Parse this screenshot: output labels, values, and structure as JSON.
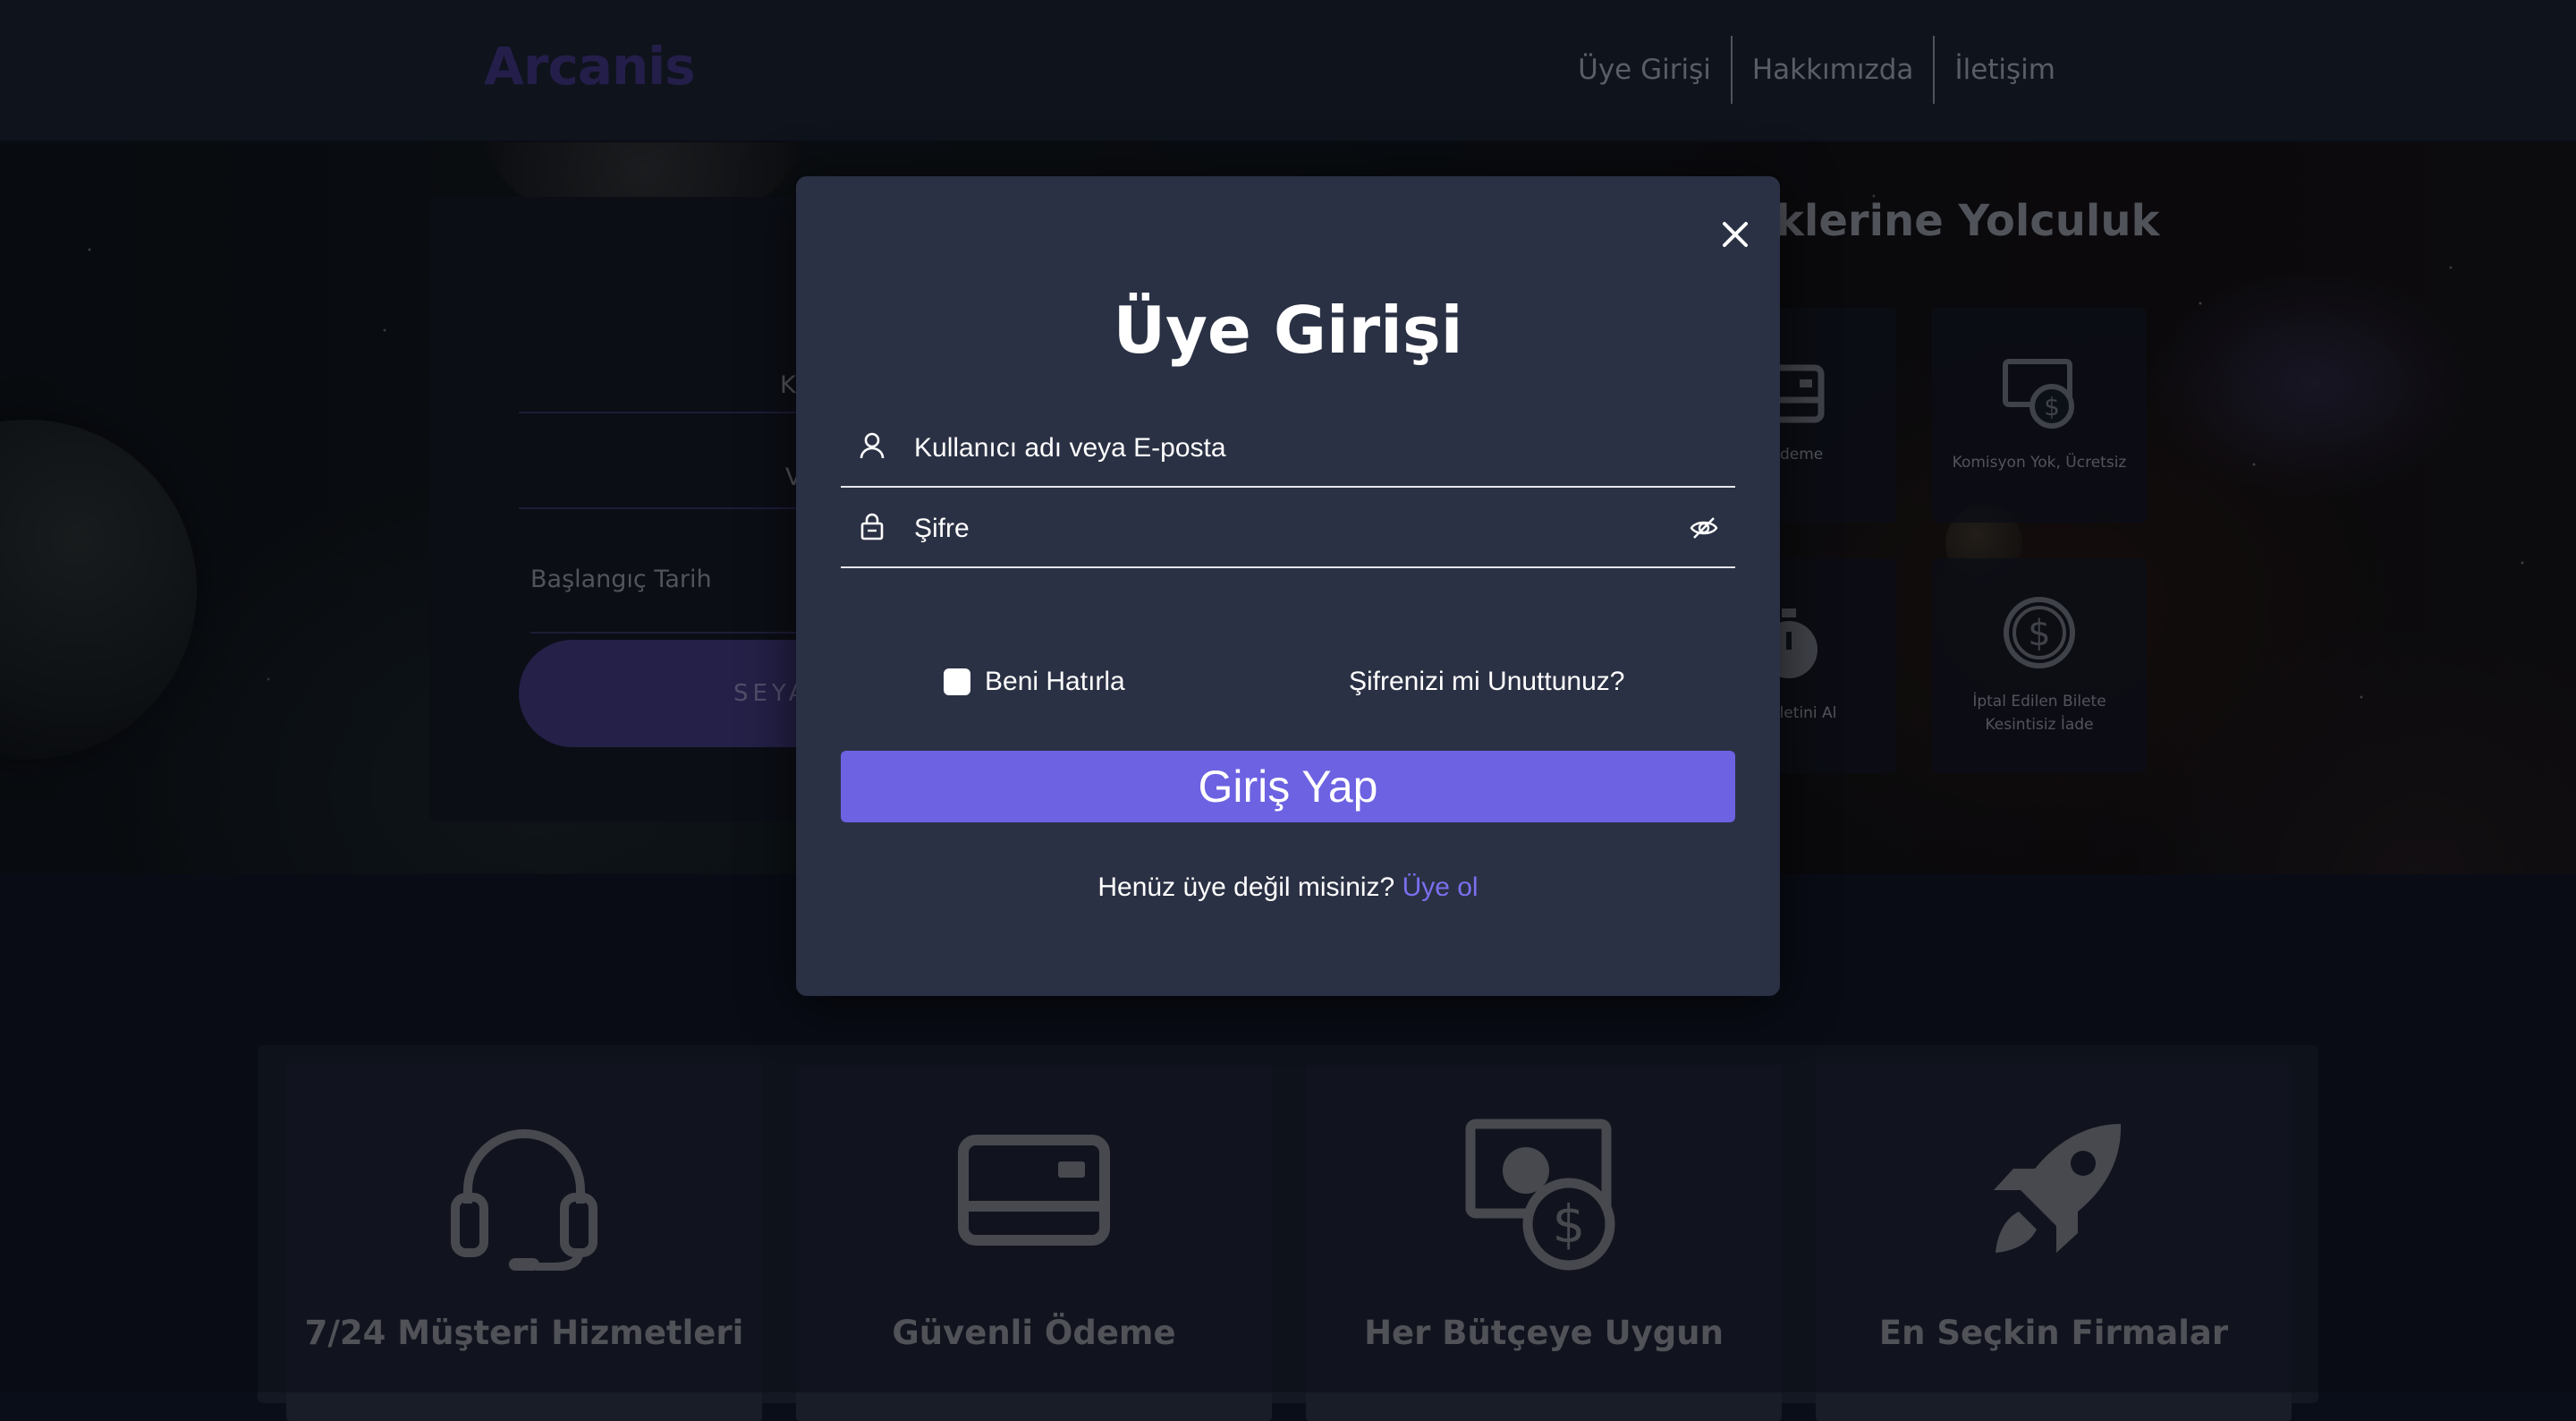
{
  "navbar": {
    "brand": "Arcanis",
    "links": [
      "Üye Girişi",
      "Hakkımızda",
      "İletişim"
    ]
  },
  "hero": {
    "title_fragment": "klerine Yolculuk",
    "search": {
      "field1_fragment": "K",
      "field2_fragment": "V",
      "start_date_label": "Başlangıç Tarih",
      "button_fragment": "SEYA"
    },
    "tiles": [
      {
        "label": "li Ödeme",
        "icon": "credit-card-icon"
      },
      {
        "label": "Komisyon Yok, Ücretsiz",
        "icon": "money-bill-icon"
      },
      {
        "label": "da Biletini Al",
        "icon": "stopwatch-icon"
      },
      {
        "label": "İptal Edilen Bilete Kesintisiz İade",
        "icon": "dollar-circle-icon"
      }
    ]
  },
  "features": [
    {
      "label": "7/24 Müşteri Hizmetleri",
      "icon": "headset-icon"
    },
    {
      "label": "Güvenli Ödeme",
      "icon": "credit-card-icon"
    },
    {
      "label": "Her Bütçeye Uygun",
      "icon": "money-bill-icon"
    },
    {
      "label": "En Seçkin Firmalar",
      "icon": "rocket-icon"
    }
  ],
  "modal": {
    "title": "Üye Girişi",
    "username_placeholder": "Kullanıcı adı veya E-posta",
    "password_placeholder": "Şifre",
    "remember_label": "Beni Hatırla",
    "forgot_label": "Şifrenizi mi Unuttunuz?",
    "login_button": "Giriş Yap",
    "signup_prompt": "Henüz üye değil misiniz?",
    "signup_link": "Üye ol"
  },
  "colors": {
    "accent": "#6c62e2",
    "link": "#7b6ff0",
    "modal_bg": "#2b3144",
    "brand": "#3b2e78"
  }
}
